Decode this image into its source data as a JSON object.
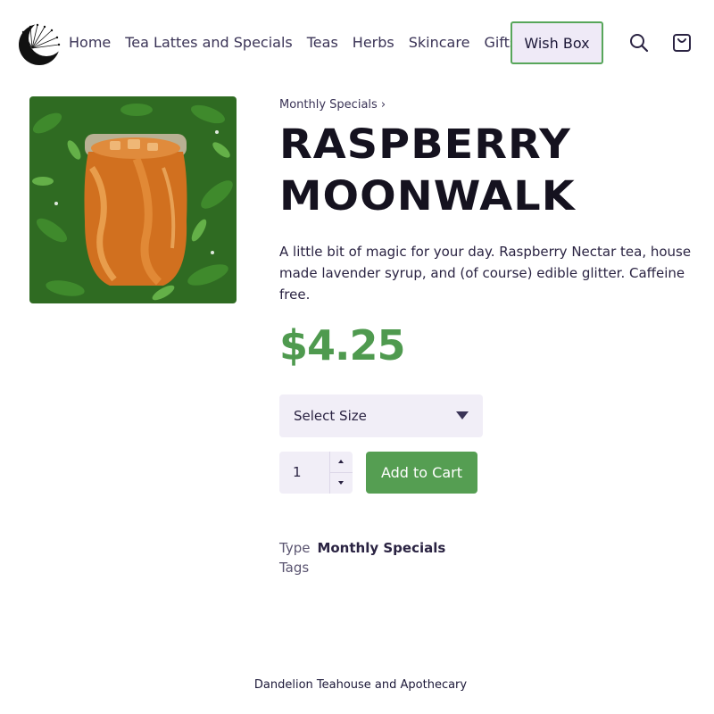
{
  "header": {
    "nav": [
      "Home",
      "Tea Lattes and Specials",
      "Teas",
      "Herbs",
      "Skincare",
      "Gifts"
    ],
    "wish_box_label": "Wish Box",
    "icons": {
      "search": "search-icon",
      "cart": "cart-icon",
      "logo": "crescent-moon-dandelion-logo"
    }
  },
  "product": {
    "breadcrumb": "Monthly Specials ›",
    "title_line1": "RASPBERRY",
    "title_line2": "MOONWALK",
    "description": "A little bit of magic for your day. Raspberry Nectar tea, house made lavender syrup, and (of course) edible glitter. Caffeine free.",
    "price": "$4.25",
    "size_select_label": "Select Size",
    "quantity": "1",
    "add_to_cart_label": "Add to Cart",
    "type_label": "Type",
    "type_value": "Monthly Specials",
    "tags_label": "Tags"
  },
  "footer": {
    "text": "Dandelion Teahouse and Apothecary"
  },
  "colors": {
    "accent_green": "#559e52",
    "wish_box_bg": "#efeaf7",
    "text_dark": "#15121f"
  }
}
